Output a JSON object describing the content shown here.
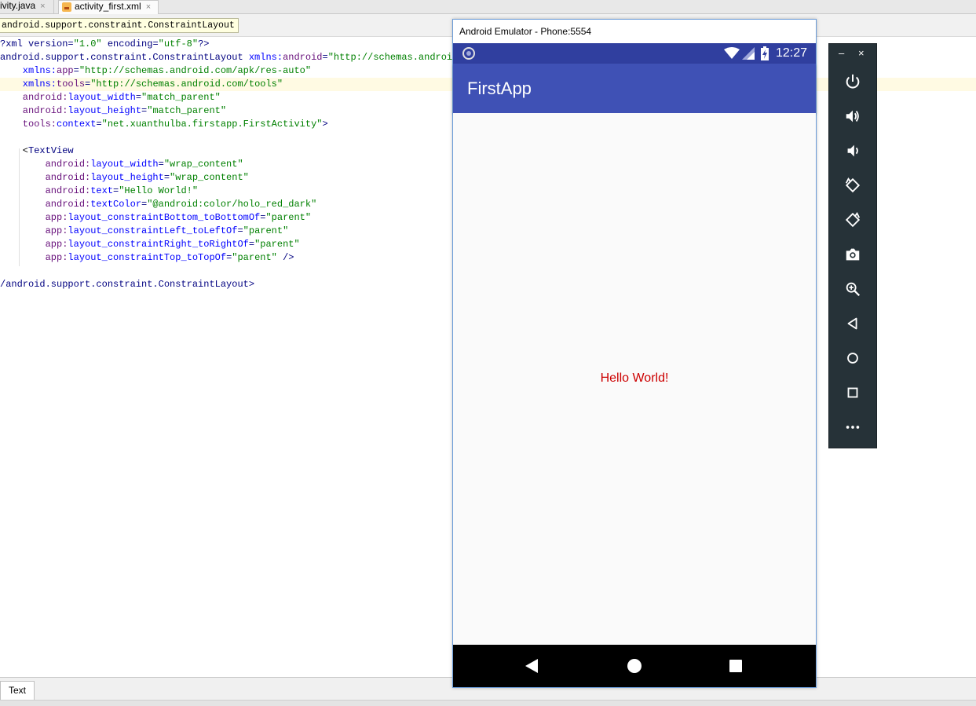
{
  "tabs": [
    {
      "label": "ivity.java",
      "close": "×"
    },
    {
      "label": "activity_first.xml",
      "close": "×"
    }
  ],
  "breadcrumb": "android.support.constraint.ConstraintLayout",
  "code": {
    "l1": {
      "a": "?xml version=",
      "b": "\"1.0\"",
      "c": " encoding=",
      "d": "\"utf-8\"",
      "e": "?>"
    },
    "l2": {
      "a": "android.support.constraint.ConstraintLayout ",
      "b": "xmlns:",
      "c": "android",
      "d": "=",
      "e": "\"http://schemas.android."
    },
    "l3": {
      "a": "    xmlns:",
      "b": "app",
      "c": "=",
      "d": "\"http://schemas.android.com/apk/res-auto\""
    },
    "l4": {
      "a": "    xmlns:",
      "b": "tools",
      "c": "=",
      "d": "\"http://schemas.android.com/tools\""
    },
    "l5": {
      "a": "    android:",
      "b": "layout_width",
      "c": "=",
      "d": "\"match_parent\""
    },
    "l6": {
      "a": "    android:",
      "b": "layout_height",
      "c": "=",
      "d": "\"match_parent\""
    },
    "l7": {
      "a": "    tools:",
      "b": "context",
      "c": "=",
      "d": "\"net.xuanthulba.firstapp.FirstActivity\"",
      "e": ">"
    },
    "l8": {
      "a": "    <",
      "b": "TextView"
    },
    "l9": {
      "a": "        android:",
      "b": "layout_width",
      "c": "=",
      "d": "\"wrap_content\""
    },
    "l10": {
      "a": "        android:",
      "b": "layout_height",
      "c": "=",
      "d": "\"wrap_content\""
    },
    "l11": {
      "a": "        android:",
      "b": "text",
      "c": "=",
      "d": "\"Hello World!\""
    },
    "l12": {
      "a": "        android:",
      "b": "textColor",
      "c": "=",
      "d": "\"@android:color/holo_red_dark\""
    },
    "l13": {
      "a": "        app:",
      "b": "layout_constraintBottom_toBottomOf",
      "c": "=",
      "d": "\"parent\""
    },
    "l14": {
      "a": "        app:",
      "b": "layout_constraintLeft_toLeftOf",
      "c": "=",
      "d": "\"parent\""
    },
    "l15": {
      "a": "        app:",
      "b": "layout_constraintRight_toRightOf",
      "c": "=",
      "d": "\"parent\""
    },
    "l16": {
      "a": "        app:",
      "b": "layout_constraintTop_toTopOf",
      "c": "=",
      "d": "\"parent\"",
      "e": " />"
    },
    "l17": {
      "a": "/android.support.constraint.ConstraintLayout>"
    }
  },
  "bottom_tab": "Text",
  "emulator": {
    "window_title": "Android Emulator - Phone:5554",
    "clock": "12:27",
    "app_title": "FirstApp",
    "content_text": "Hello World!",
    "colors": {
      "status_bar": "#303f9f",
      "app_bar": "#3f51b5",
      "hello_text": "#cc0000"
    }
  },
  "toolbar": {
    "minimize": "–",
    "close": "×",
    "buttons": [
      "power-icon",
      "volume-up-icon",
      "volume-down-icon",
      "rotate-left-icon",
      "rotate-right-icon",
      "camera-icon",
      "zoom-icon",
      "back-icon",
      "home-icon",
      "overview-icon",
      "more-icon"
    ]
  }
}
